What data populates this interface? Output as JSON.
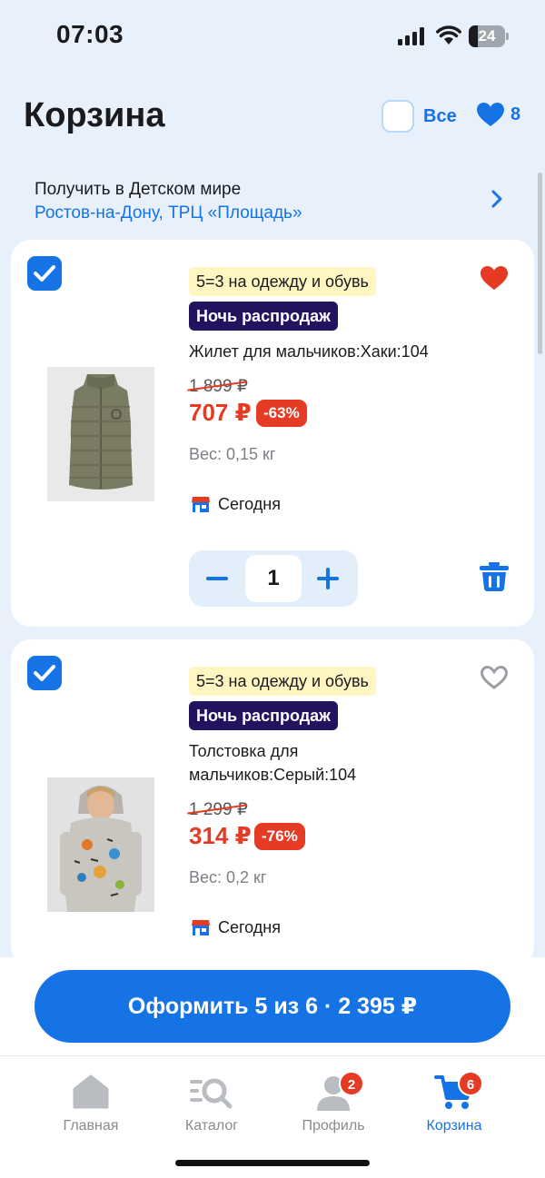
{
  "status_bar": {
    "time": "07:03",
    "battery_percent": "24",
    "battery_level": 0.24
  },
  "header": {
    "title": "Корзина",
    "select_all_label": "Все",
    "favorites_count": "8"
  },
  "pickup": {
    "title": "Получить в Детском мире",
    "address": "Ростов-на-Дону, ТРЦ «Площадь»"
  },
  "items": [
    {
      "checked": true,
      "promo": "5=3 на одежду и обувь",
      "badge": "Ночь распродаж",
      "name": "Жилет для мальчиков:Хаки:104",
      "old_price": "1 899 ₽",
      "price": "707 ₽",
      "discount": "-63%",
      "weight": "Вес: 0,15 кг",
      "delivery": "Сегодня",
      "favorite": true,
      "quantity": "1"
    },
    {
      "checked": true,
      "promo": "5=3 на одежду и обувь",
      "badge": "Ночь распродаж",
      "name": "Толстовка для мальчиков:Серый:104",
      "old_price": "1 299 ₽",
      "price": "314 ₽",
      "discount": "-76%",
      "weight": "Вес: 0,2 кг",
      "delivery": "Сегодня",
      "favorite": false
    }
  ],
  "checkout": {
    "label": "Оформить 5 из 6 · 2 395 ₽"
  },
  "nav": [
    {
      "label": "Главная",
      "icon": "home-icon"
    },
    {
      "label": "Каталог",
      "icon": "catalog-search-icon"
    },
    {
      "label": "Профиль",
      "icon": "profile-icon",
      "badge": "2"
    },
    {
      "label": "Корзина",
      "icon": "cart-icon",
      "badge": "6",
      "active": true
    }
  ],
  "colors": {
    "accent": "#1573e6",
    "sale": "#e53a24",
    "night_badge": "#23125e",
    "promo_bg": "#fff6c2",
    "background": "#e8f1fb"
  }
}
